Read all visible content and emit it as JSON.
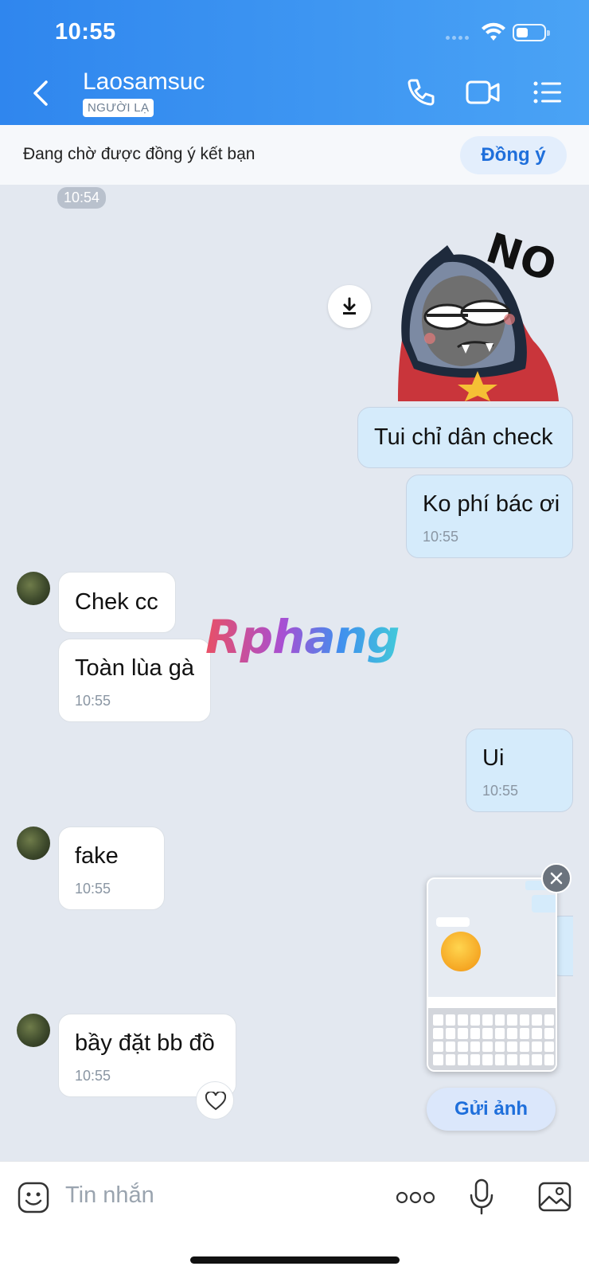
{
  "status_bar": {
    "time": "10:55"
  },
  "header": {
    "contact_name": "Laosamsuc",
    "badge": "NGƯỜI LẠ"
  },
  "friend_request": {
    "text": "Đang chờ được đồng ý kết bạn",
    "accept_label": "Đồng ý"
  },
  "separator_time": "10:54",
  "sticker_text": "NO",
  "messages": [
    {
      "from": "me",
      "text": "Tui chỉ dân check"
    },
    {
      "from": "me",
      "text": "Ko phí bác ơi",
      "time": "10:55"
    },
    {
      "from": "them",
      "text": "Chek cc"
    },
    {
      "from": "them",
      "text": "Toàn lùa gà",
      "time": "10:55"
    },
    {
      "from": "me",
      "text": "Ui",
      "time": "10:55"
    },
    {
      "from": "them",
      "text": "fake",
      "time": "10:55"
    },
    {
      "from": "them",
      "text": "bầy đặt bb đồ",
      "time": "10:55"
    }
  ],
  "preview": {
    "send_label": "Gửi ảnh"
  },
  "watermark": "Rphang",
  "input": {
    "placeholder": "Tin nhắn"
  }
}
